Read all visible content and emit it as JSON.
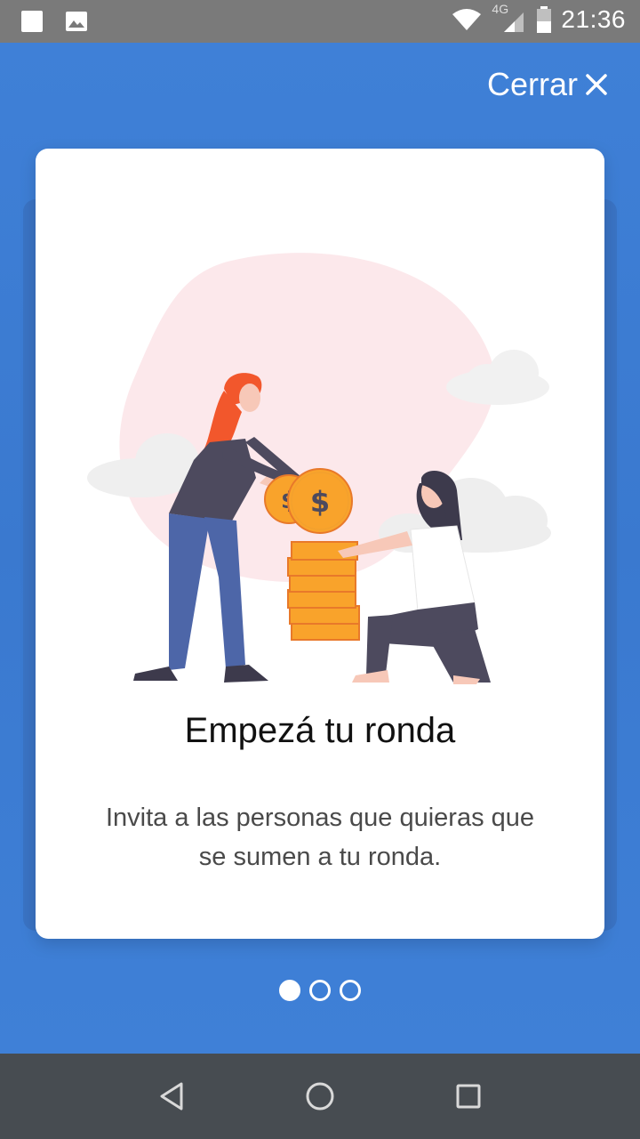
{
  "status_bar": {
    "time": "21:36",
    "network": "4G",
    "icons": [
      "square-notification-icon",
      "image-notification-icon",
      "wifi-icon",
      "signal-icon",
      "battery-icon"
    ]
  },
  "header": {
    "close_label": "Cerrar",
    "close_icon": "close-icon"
  },
  "onboarding": {
    "title": "Empezá tu ronda",
    "description": "Invita a las personas que quieras que se sumen a tu ronda.",
    "page_count": 3,
    "current_page": 1
  },
  "nav_bar": {
    "buttons": [
      "back-icon",
      "home-icon",
      "recents-icon"
    ]
  },
  "colors": {
    "background": "#3d7fd6",
    "card": "#ffffff",
    "coin": "#f9a32b",
    "blob": "#fbe4e8",
    "status_bar": "#7a7a7a",
    "nav_bar": "#474c51"
  }
}
